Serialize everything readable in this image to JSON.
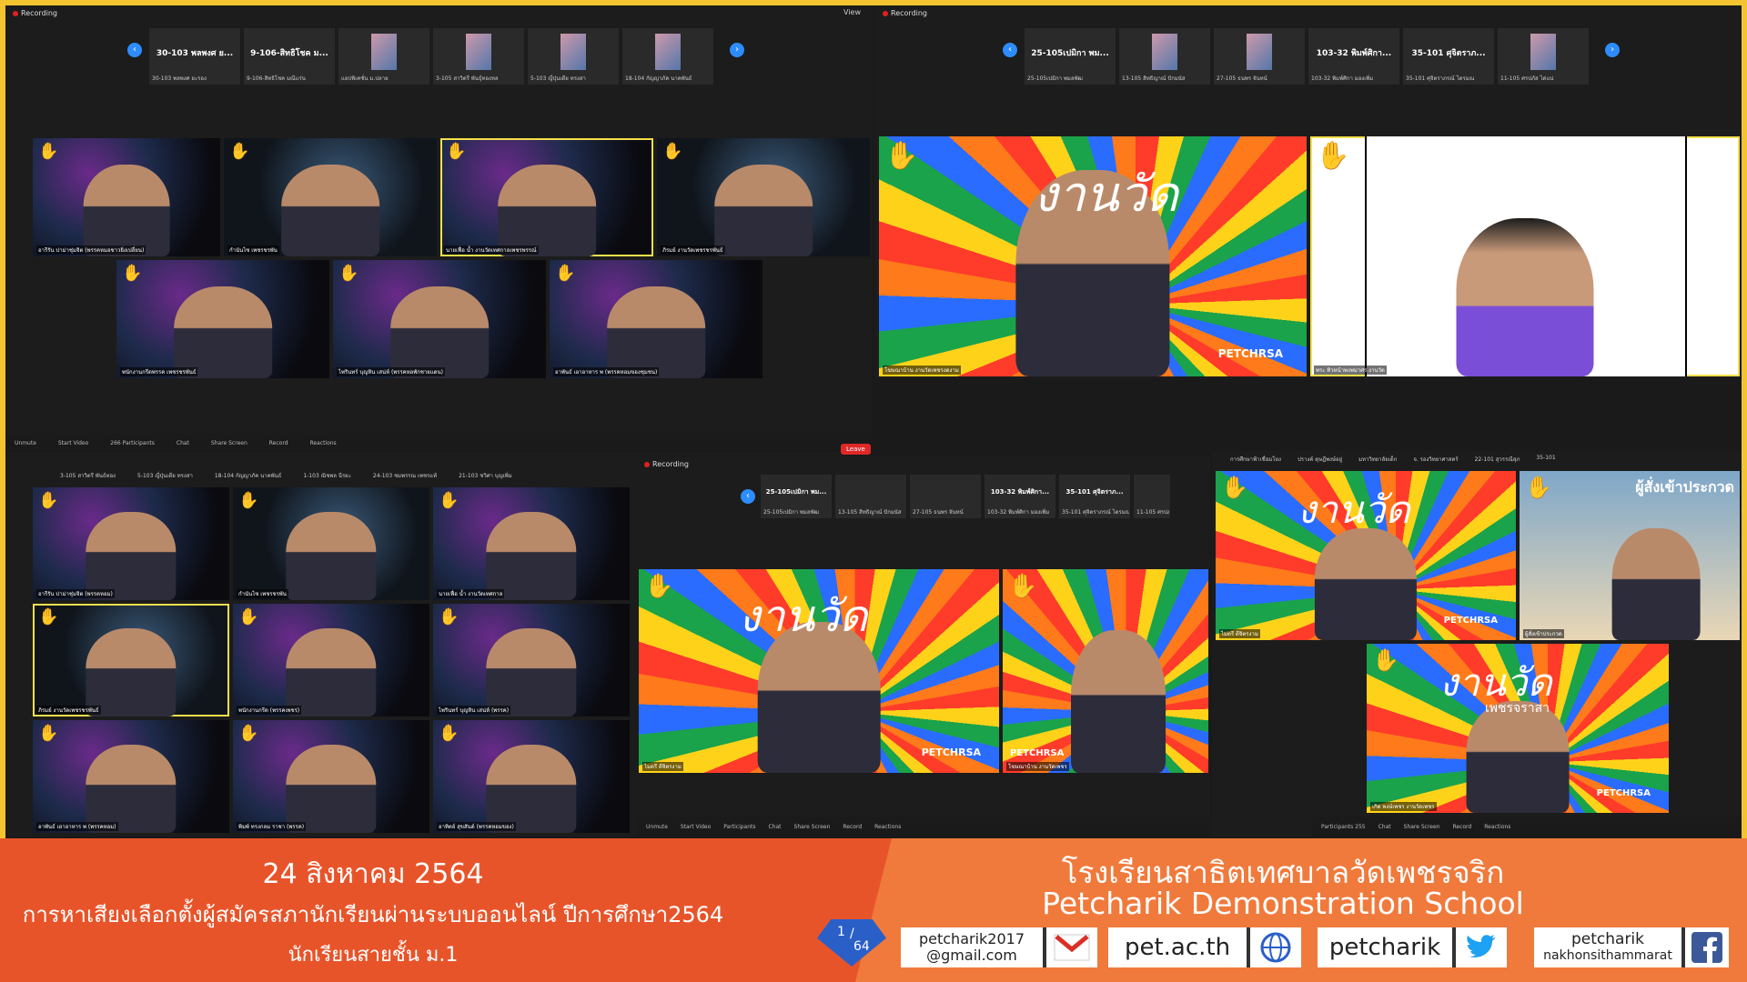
{
  "recording_label": "Recording",
  "view_label": "View",
  "pane1": {
    "thumbnails": [
      {
        "title": "30-103 พลพงศ ย...",
        "label": "30-103 พลพงศ ยะรอง"
      },
      {
        "title": "9-106-สิทธิโชค ม...",
        "label": "9-106-สิทธิโชค มณีแร่น"
      },
      {
        "title": "",
        "label": "แอปพิเคชั่น ม.ปลาย"
      },
      {
        "title": "",
        "label": "3-105 สาวิตรี พันธุ์ทองหล"
      },
      {
        "title": "",
        "label": "5-103 ญี่ปุ่นเดีย ทรงสา"
      },
      {
        "title": "",
        "label": "18-104 กัญญาภัค นาคพันธ์"
      }
    ],
    "tiles": [
      "อารีรัน ปาม่าชุ่มจิต (พรรคหมอชาวยิ่งเปลี่ยน)",
      "กำนันไซ เพชรชรพัน",
      "นายเฟื่อ น้ำ งานวัดเทศกาลเพชรพรรณ์",
      "ภิรมย์ งานวัดเพชรชรพันธ์",
      "พนักงานกรีดพรรค เพชรชรพันธ์",
      "ไพรินทร์ บุญหิน เสน่ห์ (พรรคหอพักชายแดน)",
      "อาพันธ์ เอาอาหาร พ (พรรคหอมของชุมชน)"
    ],
    "toolbar": [
      "Unmute",
      "Start Video",
      "266 Participants",
      "Chat",
      "Share Screen",
      "Record",
      "Reactions"
    ],
    "leave": "Leave"
  },
  "pane2": {
    "thumbnails": [
      {
        "title": "25-105เปมิกา พม...",
        "label": "25-105เปมิกา พมลพัฒ"
      },
      {
        "title": "",
        "label": "13-105 สิทธิญาณ์ ปักมนัส"
      },
      {
        "title": "",
        "label": "27-105 ธนพร จันทน์"
      },
      {
        "title": "103-32 พิมพ์ศิกา...",
        "label": "103-32 พิมพ์ศิกา มองเพิ่ม"
      },
      {
        "title": "35-101 ศุจิตราภ...",
        "label": "35-101 ศุจิตราภรณ์ ไตรมณ"
      },
      {
        "title": "",
        "label": "11-105 ศรปภัส ได่แน่"
      }
    ],
    "tiles": [
      "โฆษณาบ้าน งานวัดเพชรงดงาม",
      "พระ ทิวหน้าพงพม่าศร งานวัด"
    ]
  },
  "pane3": {
    "strip": [
      "3-105 สาวิตรี พันธ์ทอง",
      "5-103 ญี่ปุ่นเดีย ทรงสา",
      "18-104 กัญญาภัค นาคพันธ์",
      "1-103 ณิชพล นีรยะ",
      "24-103 ชมพรรณ เพชรแท้",
      "21-103 ชวิศา บุญเพิ่ม"
    ],
    "tiles": [
      "อารีรัน ปาม่าชุ่มจิต (พรรคหอม)",
      "กำนันไซ เพชรชรพัน",
      "นายเฟื่อ น้ำ งานวัดเทศกาล",
      "ภิรมย์ งานวัดเพชรชรพันธ์",
      "พนักงานกรีด (พรรคเพชร)",
      "ไพรินทร์ บุญหิน เสน่ห์ (พรรค)",
      "อาพันธ์ เอาอาหาร พ (พรรคหอม)",
      "พิมพ์ ทรงกลม ราชา (พรรค)",
      "อาทิตย์ สุขสันต์ (พรรคหอมของ)"
    ]
  },
  "pane4": {
    "thumbnails": [
      {
        "title": "25-105เปมิกา พม...",
        "label": "25-105เปมิกา พมลพัฒ"
      },
      {
        "title": "",
        "label": "13-105 สิทธิญาณ์ ปักมนัส"
      },
      {
        "title": "",
        "label": "27-105 ธนพร จันทน์"
      },
      {
        "title": "103-32 พิมพ์ศิกา...",
        "label": "103-32 พิมพ์ศิกา มองเพิ่ม"
      },
      {
        "title": "35-101 ศุจิตราภ...",
        "label": "35-101 ศุจิตราภรณ์ ไตรมณ"
      },
      {
        "title": "",
        "label": "11-105 ศรปภัส ได่แน่"
      }
    ],
    "tiles": [
      "ไมตรี ดีจิตรงาม",
      "โฆษณาบ้าน งานวัดเพชร"
    ],
    "toolbar": [
      "Unmute",
      "Start Video",
      "Participants",
      "Chat",
      "Share Screen",
      "Record",
      "Reactions"
    ]
  },
  "pane5": {
    "strip": [
      "การศึกษาฟ้าเชื่อมโยง",
      "ปรางค์ ดุษฎีพงษ์อยู่",
      "มหาวิทยาลัยเด็ก",
      "จ. รองวิทยาศาสตร์",
      "22-101 สุวรรณีสุภ",
      "35-101"
    ],
    "tiles": [
      "ไมตรี ดีจิตรงาม",
      "ผู้สั่งเข้าประกวด",
      "เกิด พงษ์เพชร งานวัดเพชร"
    ],
    "poster": "ผู้สั่งเข้าประกวด",
    "toolbar": [
      "Participants 255",
      "Chat",
      "Share Screen",
      "Record",
      "Reactions"
    ]
  },
  "festival_text": "งานวัด",
  "festival_sub": "เพชรจราสา",
  "logo_text": "PETCHRSA",
  "banner": {
    "date": "24 สิงหาคม 2564",
    "line2": "การหาเสียงเลือกตั้งผู้สมัครสภานักเรียนผ่านระบบออนไลน์ ปีการศึกษา2564",
    "line3": "นักเรียนสายชั้น ม.1",
    "school_th": "โรงเรียนสาธิตเทศบาลวัดเพชรจริก",
    "school_en": "Petcharik Demonstration School",
    "page_num": "1",
    "page_total": "64",
    "email_line1": "petcharik2017",
    "email_line2": "@gmail.com",
    "website": "pet.ac.th",
    "twitter": "petcharik",
    "facebook_line1": "petcharik",
    "facebook_line2": "nakhonsithammarat"
  },
  "colors": {
    "border": "#f4c430",
    "banner": "#e8542a",
    "accent": "#2d8cff",
    "leave": "#e02828"
  }
}
